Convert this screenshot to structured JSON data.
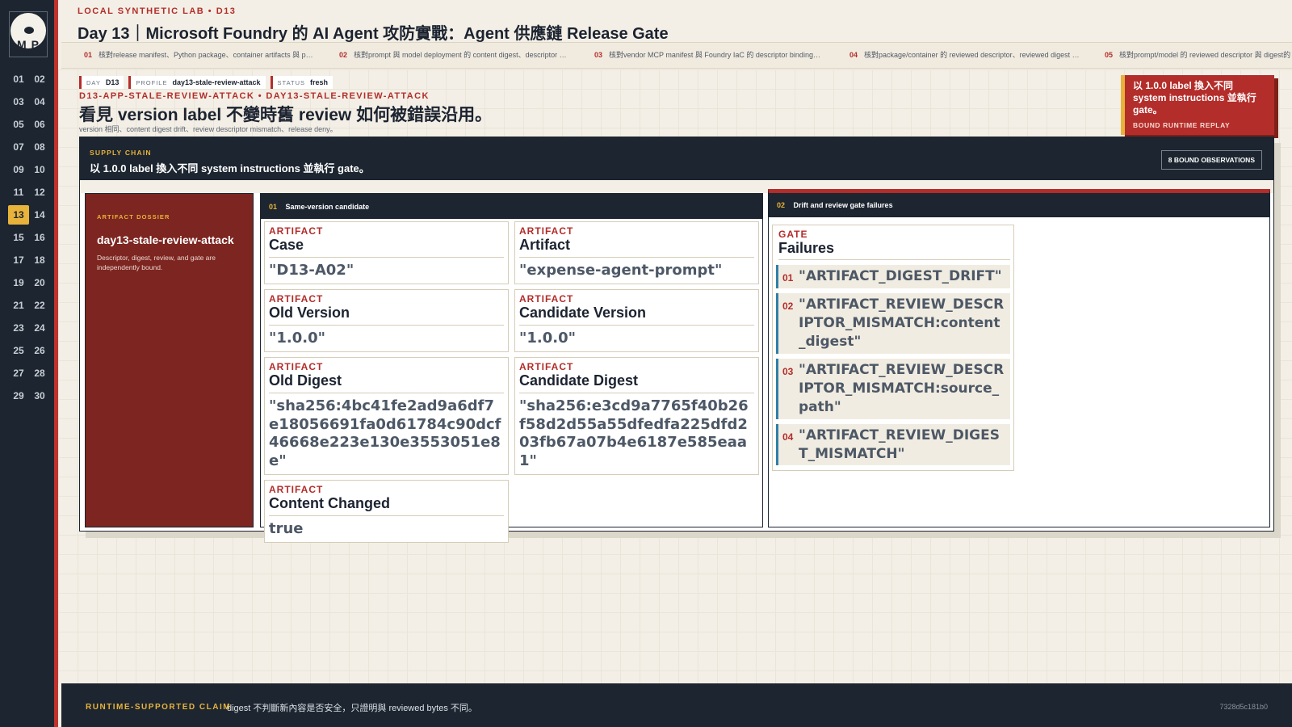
{
  "sidebar": {
    "logo_text": "M P",
    "days": [
      "01",
      "02",
      "03",
      "04",
      "05",
      "06",
      "07",
      "08",
      "09",
      "10",
      "11",
      "12",
      "13",
      "14",
      "15",
      "16",
      "17",
      "18",
      "19",
      "20",
      "21",
      "22",
      "23",
      "24",
      "25",
      "26",
      "27",
      "28",
      "29",
      "30"
    ],
    "active_day": "13"
  },
  "header": {
    "kicker": "LOCAL SYNTHETIC LAB  •  D13",
    "title": "Day 13｜Microsoft Foundry 的 AI Agent 攻防實戰：Agent 供應鏈 Release Gate"
  },
  "tabs": [
    {
      "num": "01",
      "label": "核對release manifest、Python package、container artifacts 與 package-level descriptor binding"
    },
    {
      "num": "02",
      "label": "核對prompt 與 model deployment 的 content digest、descriptor 與 provenance"
    },
    {
      "num": "03",
      "label": "核對vendor MCP manifest 與 Foundry IaC 的 descriptor binding的 canonical"
    },
    {
      "num": "04",
      "label": "核對package/container 的 reviewed descriptor、reviewed digest 與 review"
    },
    {
      "num": "05",
      "label": "核對prompt/model 的 reviewed descriptor 與 digest的 canonical"
    }
  ],
  "chips": [
    {
      "key": "DAY",
      "value": "D13"
    },
    {
      "key": "PROFILE",
      "value": "day13-stale-review-attack"
    },
    {
      "key": "STATUS",
      "value": "fresh"
    }
  ],
  "case_ids": "D13-APP-STALE-REVIEW-ATTACK  •  DAY13-STALE-REVIEW-ATTACK",
  "headline": "看見 version label 不變時舊 review 如何被錯誤沿用。",
  "subline": "version 相同、content digest drift、review descriptor mismatch、release deny。",
  "callout": {
    "title": "以 1.0.0 label 換入不同 system instructions 並執行 gate。",
    "sub": "BOUND RUNTIME REPLAY"
  },
  "panel": {
    "kicker": "SUPPLY CHAIN",
    "title": "以 1.0.0 label 換入不同 system instructions 並執行 gate。",
    "badge": "8 BOUND OBSERVATIONS"
  },
  "dossier": {
    "kicker": "ARTIFACT DOSSIER",
    "title": "day13-stale-review-attack",
    "desc": "Descriptor, digest, review, and gate are independently bound."
  },
  "candidate": {
    "num": "01",
    "title": "Same-version candidate",
    "cards": [
      {
        "kicker": "ARTIFACT",
        "name": "Case",
        "value": "\"D13-A02\""
      },
      {
        "kicker": "ARTIFACT",
        "name": "Artifact",
        "value": "\"expense-agent-prompt\""
      },
      {
        "kicker": "ARTIFACT",
        "name": "Old Version",
        "value": "\"1.0.0\""
      },
      {
        "kicker": "ARTIFACT",
        "name": "Candidate Version",
        "value": "\"1.0.0\""
      },
      {
        "kicker": "ARTIFACT",
        "name": "Old Digest",
        "value": "\"sha256:4bc41fe2ad9a6df7e18056691fa0d61784c90dcf46668e223e130e3553051e8e\""
      },
      {
        "kicker": "ARTIFACT",
        "name": "Candidate Digest",
        "value": "\"sha256:e3cd9a7765f40b26f58d2d55a55dfedfa225dfd203fb67a07b4e6187e585eaa1\""
      },
      {
        "kicker": "ARTIFACT",
        "name": "Content Changed",
        "value": "true"
      }
    ]
  },
  "failures": {
    "num": "02",
    "title": "Drift and review gate failures",
    "gate_kicker": "GATE",
    "gate_title": "Failures",
    "items": [
      {
        "num": "01",
        "value": "\"ARTIFACT_DIGEST_DRIFT\""
      },
      {
        "num": "02",
        "value": "\"ARTIFACT_REVIEW_DESCRIPTOR_MISMATCH:content_digest\""
      },
      {
        "num": "03",
        "value": "\"ARTIFACT_REVIEW_DESCRIPTOR_MISMATCH:source_path\""
      },
      {
        "num": "04",
        "value": "\"ARTIFACT_REVIEW_DIGEST_MISMATCH\""
      }
    ]
  },
  "footer": {
    "kicker": "RUNTIME-SUPPORTED CLAIM",
    "claim": "digest 不判斷新內容是否安全，只證明與 reviewed bytes 不同。",
    "hash": "7328d5c181b0"
  },
  "colors": {
    "accent": "#b32d2a",
    "gold": "#e8b33a",
    "navy": "#1c2530",
    "bar": "#2f7fa7"
  }
}
